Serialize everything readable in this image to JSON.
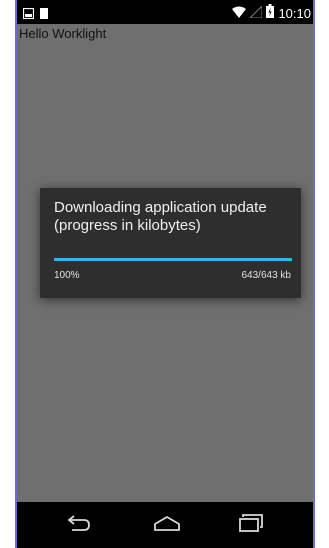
{
  "status_bar": {
    "time": "10:10",
    "icons": [
      "image-notification-icon",
      "storage-notification-icon",
      "wifi-icon",
      "signal-icon",
      "battery-icon"
    ]
  },
  "app": {
    "greeting": "Hello Worklight"
  },
  "dialog": {
    "title": "Downloading application update (progress in kilobytes)",
    "progress_fraction": 1.0,
    "percent_label": "100%",
    "count_label": "643/643 kb",
    "accent_color": "#33b5e5"
  },
  "nav_bar": {
    "buttons": [
      "back-icon",
      "home-icon",
      "recent-apps-icon"
    ]
  }
}
